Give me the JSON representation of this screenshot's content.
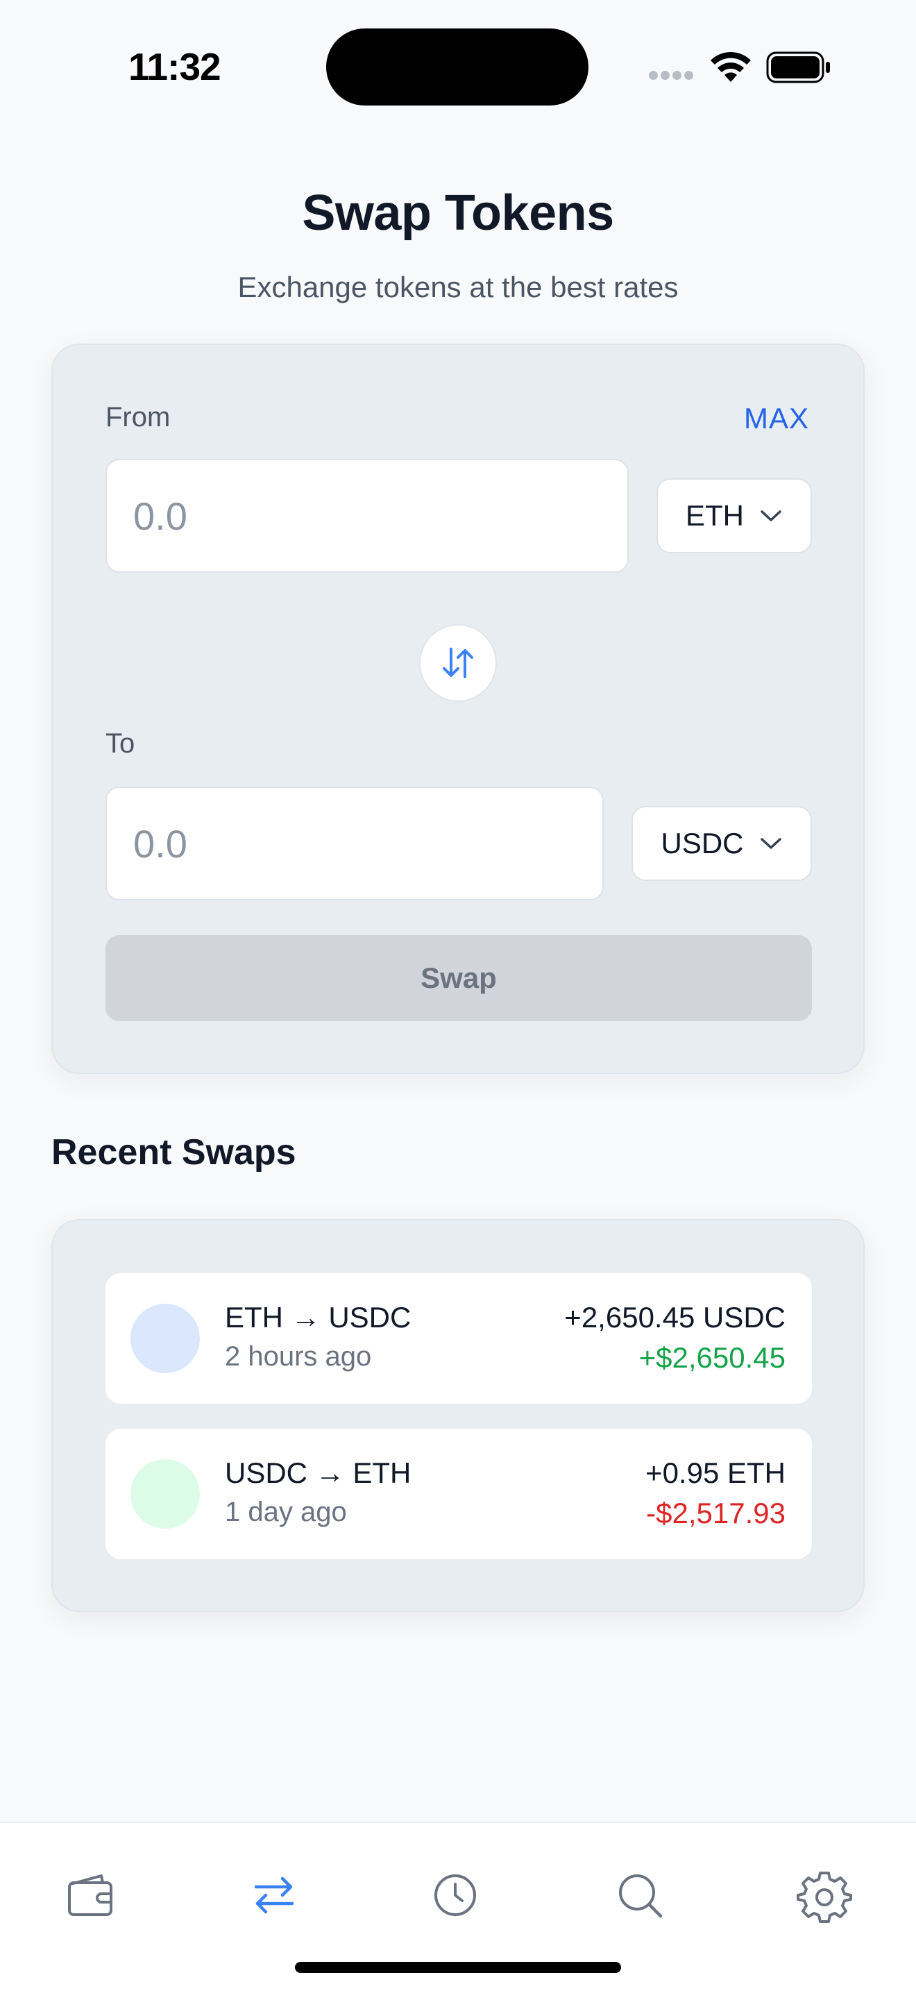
{
  "status_bar": {
    "time": "11:32"
  },
  "header": {
    "title": "Swap Tokens",
    "subtitle": "Exchange tokens at the best rates"
  },
  "swap_form": {
    "from_label": "From",
    "max_label": "MAX",
    "from_placeholder": "0.0",
    "from_token": "ETH",
    "to_label": "To",
    "to_placeholder": "0.0",
    "to_token": "USDC",
    "swap_button_label": "Swap",
    "flip_icon": "swap-vertical-arrows-icon"
  },
  "recent": {
    "title": "Recent Swaps",
    "items": [
      {
        "pair": "ETH → USDC",
        "time": "2 hours ago",
        "amount": "+2,650.45 USDC",
        "value": "+$2,650.45",
        "value_color": "#16a34a",
        "avatar_color": "#dbe7fd"
      },
      {
        "pair": "USDC → ETH",
        "time": "1 day ago",
        "amount": "+0.95 ETH",
        "value": "-$2,517.93",
        "value_color": "#dc2626",
        "avatar_color": "#dcfce7"
      }
    ]
  },
  "tab_bar": {
    "active_color": "#3b82f6",
    "inactive_color": "#6b7280",
    "tabs": [
      {
        "icon": "wallet-icon",
        "active": false
      },
      {
        "icon": "swap-arrows-icon",
        "active": true
      },
      {
        "icon": "clock-icon",
        "active": false
      },
      {
        "icon": "search-icon",
        "active": false
      },
      {
        "icon": "gear-icon",
        "active": false
      }
    ]
  }
}
